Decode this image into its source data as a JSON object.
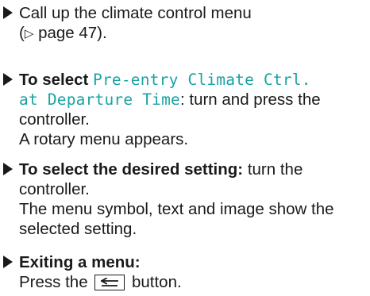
{
  "steps": [
    {
      "lines": [
        {
          "text": "Call up the climate control menu"
        },
        {
          "ref_open": "(",
          "ref_glyph": "▷",
          "ref_text": " page 47)."
        }
      ]
    },
    {
      "lead_bold": "To select ",
      "mono_1": "Pre-entry Climate Ctrl.",
      "mono_2": "at Departure Time",
      "rest_2": ": turn and press the",
      "line_3": "controller.",
      "line_4": "A rotary menu appears."
    },
    {
      "lead_bold": "To select the desired setting:",
      "rest_1": " turn the",
      "line_2": "controller.",
      "line_3": "The menu symbol, text and image show the",
      "line_4": "selected setting."
    },
    {
      "lead_bold": "Exiting a menu:",
      "line_2_pre": "Press the ",
      "button_icon": "back-arrow-icon",
      "line_2_post": " button."
    }
  ],
  "colors": {
    "text": "#1a1a1a",
    "display_text": "#1aa3a3"
  }
}
